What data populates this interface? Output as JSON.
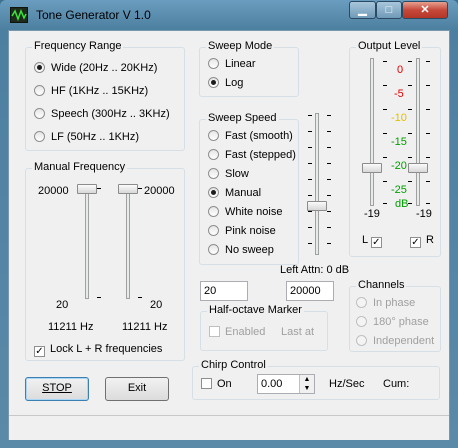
{
  "window": {
    "title": "Tone Generator V 1.0",
    "minimize": "▁",
    "maximize": "□",
    "close": "✕"
  },
  "frequency_range": {
    "label": "Frequency Range",
    "options": [
      {
        "label": "Wide (20Hz .. 20KHz)",
        "selected": true
      },
      {
        "label": "HF (1KHz .. 15KHz)",
        "selected": false
      },
      {
        "label": "Speech (300Hz .. 3KHz)",
        "selected": false
      },
      {
        "label": "LF (50Hz .. 1KHz)",
        "selected": false
      }
    ]
  },
  "manual_frequency": {
    "label": "Manual Frequency",
    "max_left": "20000",
    "max_right": "20000",
    "min_left": "20",
    "min_right": "20",
    "left_value": "11211 Hz",
    "right_value": "11211 Hz",
    "lock_label": "Lock L + R frequencies",
    "lock_checked": true
  },
  "sweep_mode": {
    "label": "Sweep Mode",
    "options": [
      {
        "label": "Linear",
        "selected": false
      },
      {
        "label": "Log",
        "selected": true
      }
    ]
  },
  "sweep_speed": {
    "label": "Sweep Speed",
    "options": [
      {
        "label": "Fast (smooth)",
        "selected": false
      },
      {
        "label": "Fast (stepped)",
        "selected": false
      },
      {
        "label": "Slow",
        "selected": false
      },
      {
        "label": "Manual",
        "selected": true
      },
      {
        "label": "White noise",
        "selected": false
      },
      {
        "label": "Pink noise",
        "selected": false
      },
      {
        "label": "No sweep",
        "selected": false
      }
    ]
  },
  "output_level": {
    "label": "Output Level",
    "scale": [
      "0",
      "-5",
      "-10",
      "-15",
      "-20",
      "-25"
    ],
    "unit": "dB",
    "left_value": "-19",
    "right_value": "-19",
    "left_channel": "L",
    "right_channel": "R",
    "left_checked": true,
    "right_checked": true,
    "colors": {
      "0": "#e00000",
      "-5": "#e00000",
      "-10": "#e0c000",
      "-15": "#00a000",
      "-20": "#00a000",
      "-25": "#00a000"
    }
  },
  "left_attn": "Left Attn: 0 dB",
  "sweep_range": {
    "start": "20",
    "end": "20000"
  },
  "half_octave": {
    "label": "Half-octave Marker",
    "enabled_label": "Enabled",
    "last_at_label": "Last at"
  },
  "channels": {
    "label": "Channels",
    "options": [
      {
        "label": "In phase",
        "selected": true
      },
      {
        "label": "180° phase",
        "selected": false
      },
      {
        "label": "Independent",
        "selected": false
      }
    ]
  },
  "chirp": {
    "label": "Chirp Control",
    "on_label": "On",
    "value": "0.00",
    "unit": "Hz/Sec",
    "cum_label": "Cum:"
  },
  "buttons": {
    "stop": "STOP",
    "exit": "Exit"
  }
}
